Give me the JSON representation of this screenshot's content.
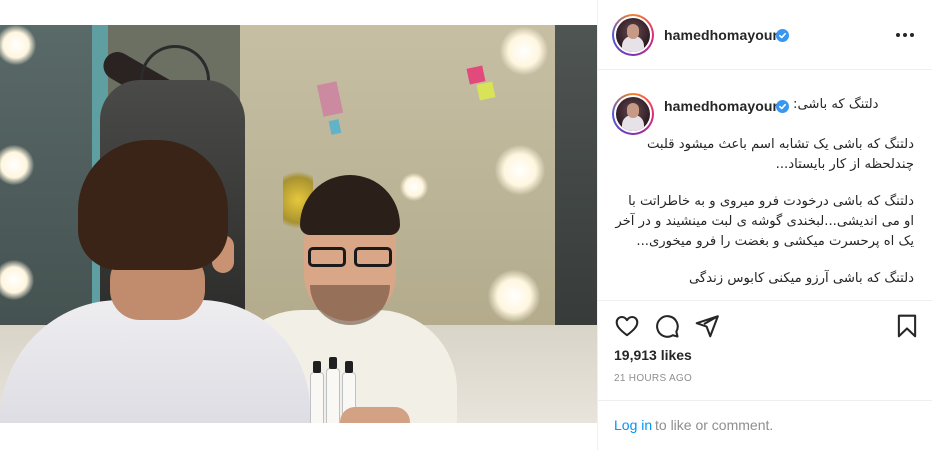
{
  "post": {
    "username": "hamedhomayoun",
    "verified": true,
    "caption": {
      "title": "دلتنگ که باشی:",
      "paragraphs": [
        "دلتنگ که باشی یک تشابه اسم باعث میشود قلبت چندلحظه از کار بایستاد...",
        "دلتنگ که باشی درخودت فرو میروی و به خاطراتت با او می اندیشی...لبخندی گوشه ی لبت مینشیند و در آخر یک اه پرحسرت میکشی و بغضت را فرو میخوری...",
        "دلتنگ که باشی آرزو میکنی کابوس زندگی"
      ]
    },
    "likes": "19,913 likes",
    "time": "21 HOURS AGO",
    "login": {
      "link_label": "Log in",
      "rest_label": "to like or comment."
    }
  },
  "icons": {
    "header_more": "more-options-icon",
    "verified": "verified-badge-icon",
    "like": "heart-icon",
    "comment": "comment-icon",
    "share": "share-icon",
    "save": "bookmark-icon"
  },
  "colors": {
    "accent_blue": "#0095f6",
    "verified_blue": "#3897f0",
    "text_primary": "#262626",
    "text_secondary": "#8e8e8e",
    "divider": "#efefef"
  }
}
